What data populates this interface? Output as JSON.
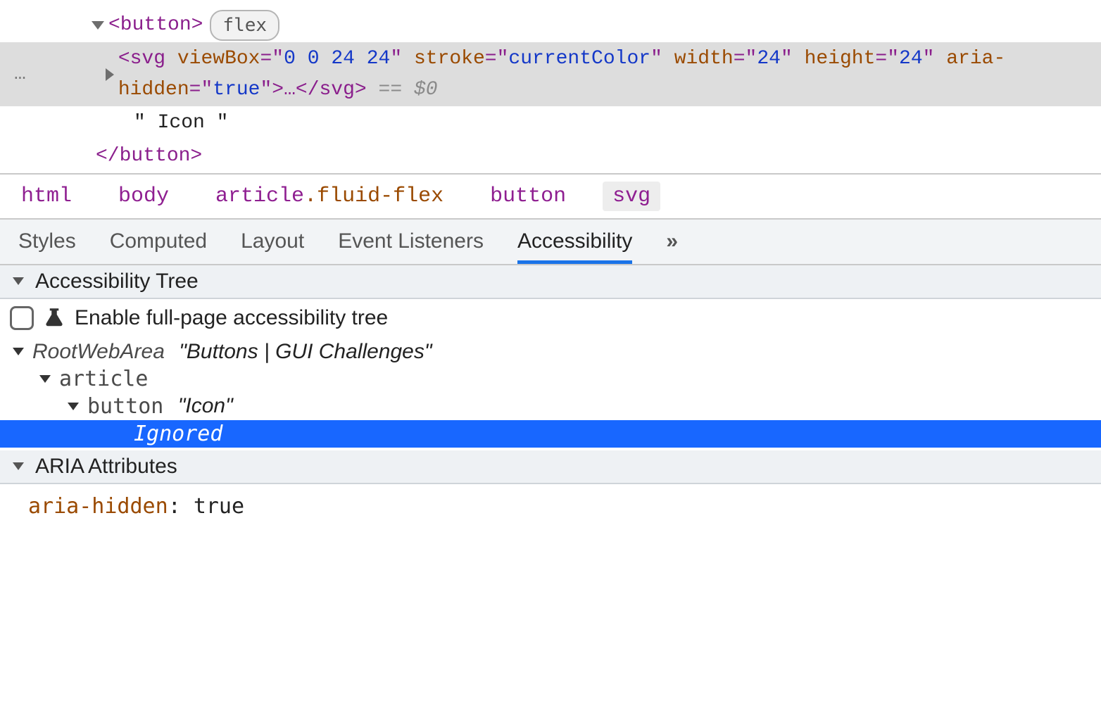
{
  "dom": {
    "button_open": "<button>",
    "button_close": "</button>",
    "flex_badge": "flex",
    "svg_tag_open": "<",
    "svg_name": "svg",
    "svg_attrs": [
      {
        "name": "viewBox",
        "value": "0 0 24 24"
      },
      {
        "name": "stroke",
        "value": "currentColor"
      },
      {
        "name": "width",
        "value": "24"
      },
      {
        "name": "height",
        "value": "24"
      },
      {
        "name": "aria-hidden",
        "value": "true"
      }
    ],
    "svg_collapsed_tail": ">…</svg>",
    "eq_dollar": " == $0",
    "text_node": "\" Icon \"",
    "ellipsis": "…"
  },
  "breadcrumb": [
    {
      "label": "html"
    },
    {
      "label": "body"
    },
    {
      "label": "article",
      "cls": ".fluid-flex"
    },
    {
      "label": "button"
    },
    {
      "label": "svg",
      "active": true
    }
  ],
  "tabs": {
    "items": [
      "Styles",
      "Computed",
      "Layout",
      "Event Listeners",
      "Accessibility"
    ],
    "more": "»",
    "active_index": 4
  },
  "a11y": {
    "tree_header": "Accessibility Tree",
    "enable_label": "Enable full-page accessibility tree",
    "root_role": "RootWebArea",
    "root_name": "\"Buttons | GUI Challenges\"",
    "article_role": "article",
    "button_role": "button",
    "button_name": "\"Icon\"",
    "ignored_label": "Ignored",
    "aria_header": "ARIA Attributes",
    "aria_key": "aria-hidden",
    "aria_val": "true"
  }
}
